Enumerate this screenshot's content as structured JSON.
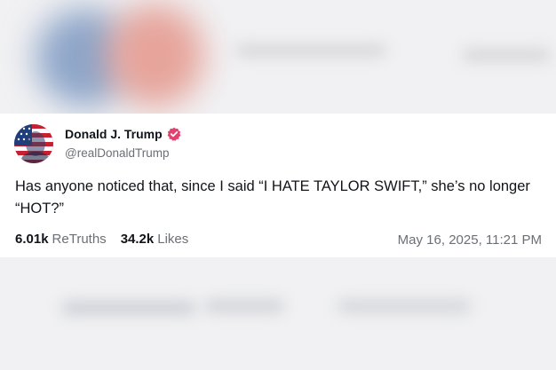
{
  "post": {
    "author": {
      "display_name": "Donald J. Trump",
      "handle": "@realDonaldTrump",
      "verified": true
    },
    "text": "Has anyone noticed that, since I said “I HATE TAYLOR SWIFT,” she’s no longer “HOT?”",
    "stats": {
      "retruths_count": "6.01k",
      "retruths_label": "ReTruths",
      "likes_count": "34.2k",
      "likes_label": "Likes"
    },
    "timestamp": "May 16, 2025, 11:21 PM"
  },
  "icons": {
    "verified": "verified-badge-icon",
    "avatar": "flag-portrait-avatar"
  },
  "colors": {
    "verified_badge": "#e5416f",
    "text_primary": "#111418",
    "text_secondary": "#6b6f76",
    "card_background": "#ffffff"
  }
}
